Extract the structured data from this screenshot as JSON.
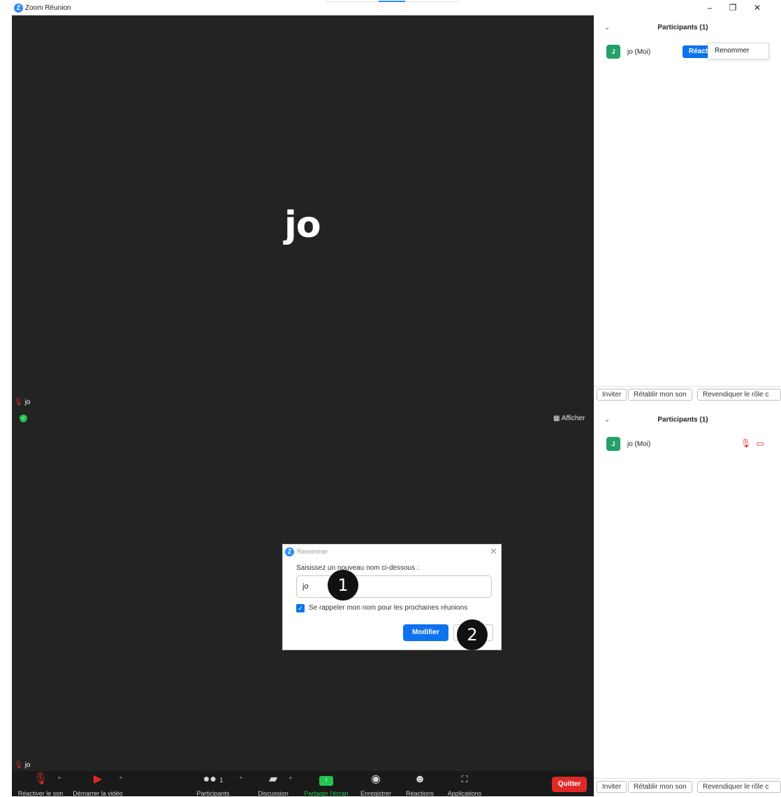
{
  "window": {
    "title": "Zoom Réunion",
    "minimize": "–",
    "restore": "❐",
    "close": "✕"
  },
  "meeting": {
    "participant_name": "jo",
    "name_tag": "jo",
    "view_label": "Afficher"
  },
  "toolbar": {
    "unmute_label": "Réactiver le son",
    "start_video_label": "Démarrer la vidéo",
    "participants_label": "Participants",
    "participants_count": "1",
    "chat_label": "Discussion",
    "share_label": "Partager l'écran",
    "record_label": "Enregistrer",
    "reactions_label": "Réactions",
    "apps_label": "Applications",
    "quit_label": "Quitter"
  },
  "panel_top": {
    "header": "Participants (1)",
    "participant": {
      "initial": "J",
      "name": "jo (Moi)"
    },
    "react_button": "Réact",
    "menu_item": "Renommer",
    "buttons": [
      "Inviter",
      "Rétablir mon son",
      "Revendiquer le rôle c"
    ]
  },
  "panel_bottom": {
    "header": "Participants (1)",
    "participant": {
      "initial": "J",
      "name": "jo (Moi)"
    },
    "buttons": [
      "Inviter",
      "Rétablir mon son",
      "Revendiquer le rôle c"
    ]
  },
  "dialog": {
    "title": "Renommer",
    "prompt": "Saisissez un nouveau nom ci-dessous :",
    "input_value": "jo",
    "remember_label": "Se rappeler mon nom pour les prochaines réunions",
    "modify_button": "Modifier",
    "close": "✕"
  },
  "markers": [
    "1",
    "2"
  ],
  "colors": {
    "accent_blue": "#0e72ed",
    "share_green": "#23c552",
    "quit_red": "#e02828",
    "meeting_bg": "#232323"
  }
}
